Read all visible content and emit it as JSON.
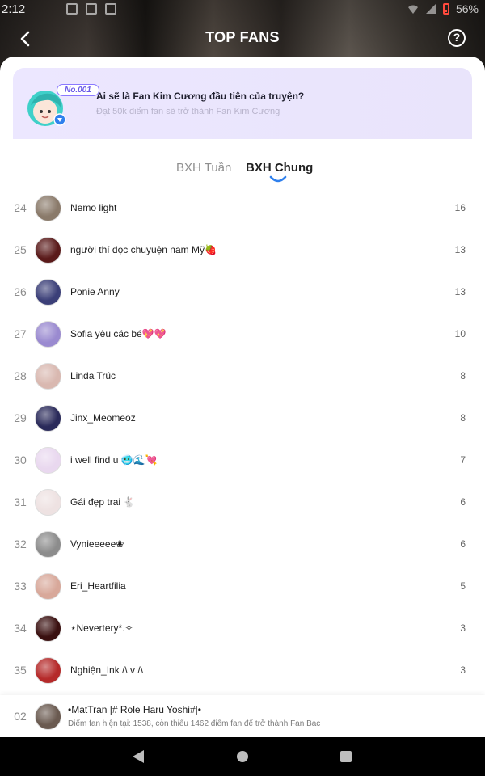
{
  "status_bar": {
    "time": "2:12",
    "battery": "56%"
  },
  "header": {
    "title": "TOP FANS"
  },
  "banner": {
    "tag": "No.001",
    "title": "Ai sẽ là Fan Kim Cương đầu tiên của truyện?",
    "subtitle": "Đạt 50k điểm fan sẽ trở thành Fan Kim Cương"
  },
  "tabs": [
    {
      "label": "BXH Tuần",
      "active": false
    },
    {
      "label": "BXH Chung",
      "active": true
    }
  ],
  "fans": [
    {
      "rank": "24",
      "name": "Nemo light",
      "score": "16",
      "avatar_color": "#8a7a6a"
    },
    {
      "rank": "25",
      "name": "người thí đọc chuyuện nam Mỹ🍓",
      "score": "13",
      "avatar_color": "#5a1a1a"
    },
    {
      "rank": "26",
      "name": "Ponie Anny",
      "score": "13",
      "avatar_color": "#3b3f78"
    },
    {
      "rank": "27",
      "name": "Sofia yêu các bé💖💖",
      "score": "10",
      "avatar_color": "#9a8ad0"
    },
    {
      "rank": "28",
      "name": "Linda Trúc",
      "score": "8",
      "avatar_color": "#d9b8b0"
    },
    {
      "rank": "29",
      "name": "Jinx_Meomeoz",
      "score": "8",
      "avatar_color": "#2a2a5a"
    },
    {
      "rank": "30",
      "name": "i well find u 🥶🌊💘",
      "score": "7",
      "avatar_color": "#e9d8ef"
    },
    {
      "rank": "31",
      "name": "Gái đẹp trai 🐇",
      "score": "6",
      "avatar_color": "#eee2e2"
    },
    {
      "rank": "32",
      "name": "Vynieeeee❀",
      "score": "6",
      "avatar_color": "#8c8c8c"
    },
    {
      "rank": "33",
      "name": "Eri_Heartfilia",
      "score": "5",
      "avatar_color": "#d8a89a"
    },
    {
      "rank": "34",
      "name": "⋆Nevertery*.✧",
      "score": "3",
      "avatar_color": "#3a1010"
    },
    {
      "rank": "35",
      "name": "Nghiện_Ink /\\ v /\\",
      "score": "3",
      "avatar_color": "#b52a2a"
    }
  ],
  "me": {
    "rank": "02",
    "name": "•MatTran |# Role Haru Yoshi#|•",
    "subtext": "Điểm fan hiện tại: 1538, còn thiếu 1462 điểm fan để trở thành Fan Bạc",
    "avatar_color": "#6a5a50"
  },
  "colors": {
    "accent": "#2f80ed",
    "banner_bg": "#ece7ff",
    "tag": "#6a5ae8"
  }
}
